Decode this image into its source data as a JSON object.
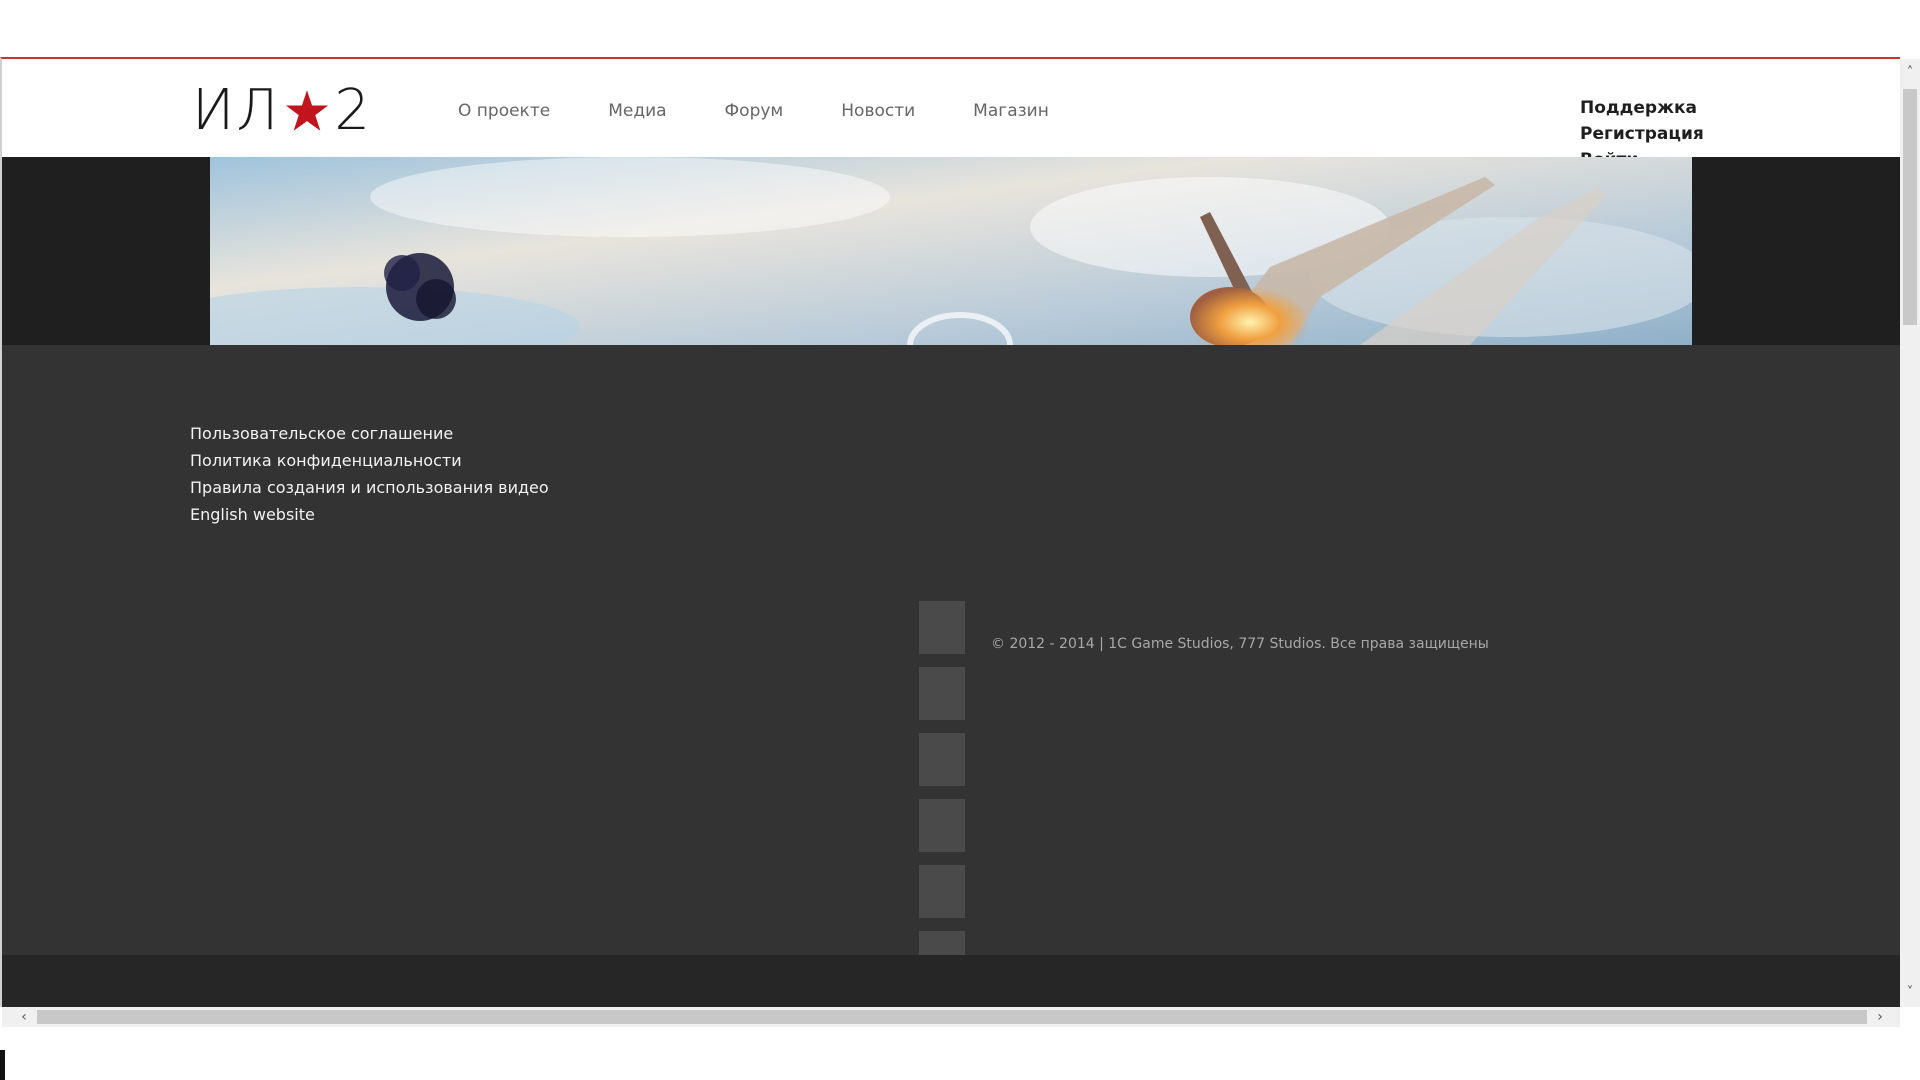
{
  "header": {
    "logo": {
      "left": "ИЛ",
      "right": "2",
      "star_color": "#c0151d"
    },
    "nav": [
      "О проекте",
      "Медиа",
      "Форум",
      "Новости",
      "Магазин"
    ],
    "user_menu": [
      "Поддержка",
      "Регистрация",
      "Войти"
    ]
  },
  "footer": {
    "links": [
      "Пользовательское соглашение",
      "Политика конфиденциальности",
      "Правила создания и использования видео",
      "English website"
    ],
    "copyright": "© 2012 - 2014 | 1C Game Studios, 777 Studios. Все права защищены",
    "social_count": 6
  },
  "colors": {
    "accent": "#c0392b",
    "footer_bg": "#333333",
    "hero_band_bg": "#1f1f1f"
  }
}
